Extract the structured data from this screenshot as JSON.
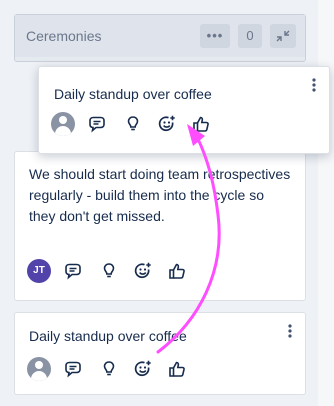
{
  "column": {
    "title": "Ceremonies",
    "more_label": "•••",
    "count": "0"
  },
  "cards": {
    "hover": {
      "text": "Daily standup over coffee",
      "menu": "⋮"
    },
    "mid": {
      "text": "We should start doing team retrospectives regularly - build them into the cycle so they don't get missed.",
      "avatar_initials": "JT"
    },
    "bottom": {
      "text": "Daily standup over coffee",
      "menu": "⋮"
    }
  },
  "colors": {
    "accent_arrow": "#ff4dff",
    "avatar_jt": "#5243aa"
  },
  "icons": [
    "comment-icon",
    "lightbulb-icon",
    "add-emoji-icon",
    "thumbs-up-icon"
  ]
}
